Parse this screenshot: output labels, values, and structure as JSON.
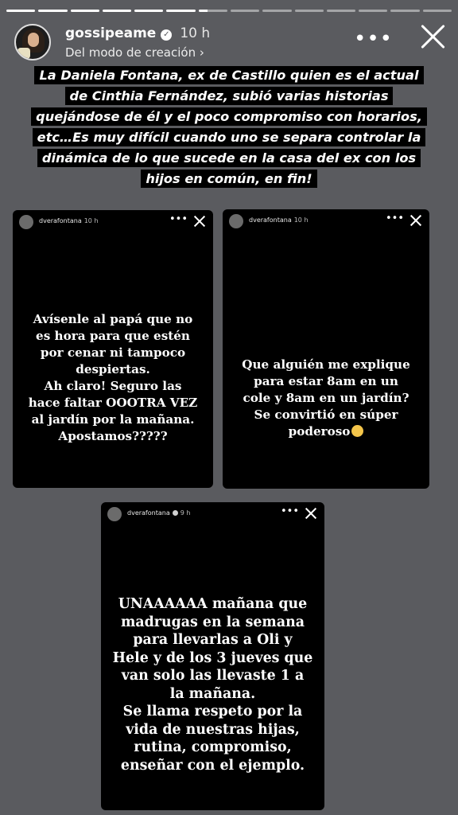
{
  "story": {
    "progress": [
      1,
      1,
      1,
      1,
      1,
      1,
      0.3,
      0,
      0,
      0,
      0,
      0,
      0,
      0
    ],
    "username": "gossipeame",
    "time": "10 h",
    "subtitle": "Del modo de creación ›",
    "more_icon": "more-icon",
    "close_icon": "close-icon"
  },
  "caption": {
    "lines": [
      "La Daniela Fontana, ex de Castillo quien es el actual",
      "de Cinthia Fernández, subió varias historias",
      "quejándose de él y el poco compromiso con horarios,",
      "etc…Es muy difícil cuando uno se separa controlar la",
      "dinámica de lo que sucede en la casa del ex con los",
      "hijos en común, en fin!"
    ]
  },
  "cards": [
    {
      "username": "dverafontana",
      "time": "10 h",
      "text": "Avísenle al papá que no\nes hora para que estén\npor cenar ni tampoco\ndespiertas.\nAh claro! Seguro las\nhace faltar OOOTRA VEZ\nal jardín por la mañana.\nApostamos?????"
    },
    {
      "username": "dverafontana",
      "time": "10 h",
      "text": "Que alguién me explique\npara estar 8am en un\ncole y 8am en un jardín?\nSe convirtió en súper\npoderoso"
    },
    {
      "username": "dverafontana",
      "time": "9 h",
      "text": "UNAAAAAA mañana que\nmadrugas en la semana\npara llevarlas a Oli y\nHele y de los 3 jueves que\nvan solo las llevaste 1 a\nla mañana.\nSe llama respeto por la\nvida de nuestras hijas,\nrutina, compromiso,\nenseñar con el ejemplo."
    }
  ]
}
